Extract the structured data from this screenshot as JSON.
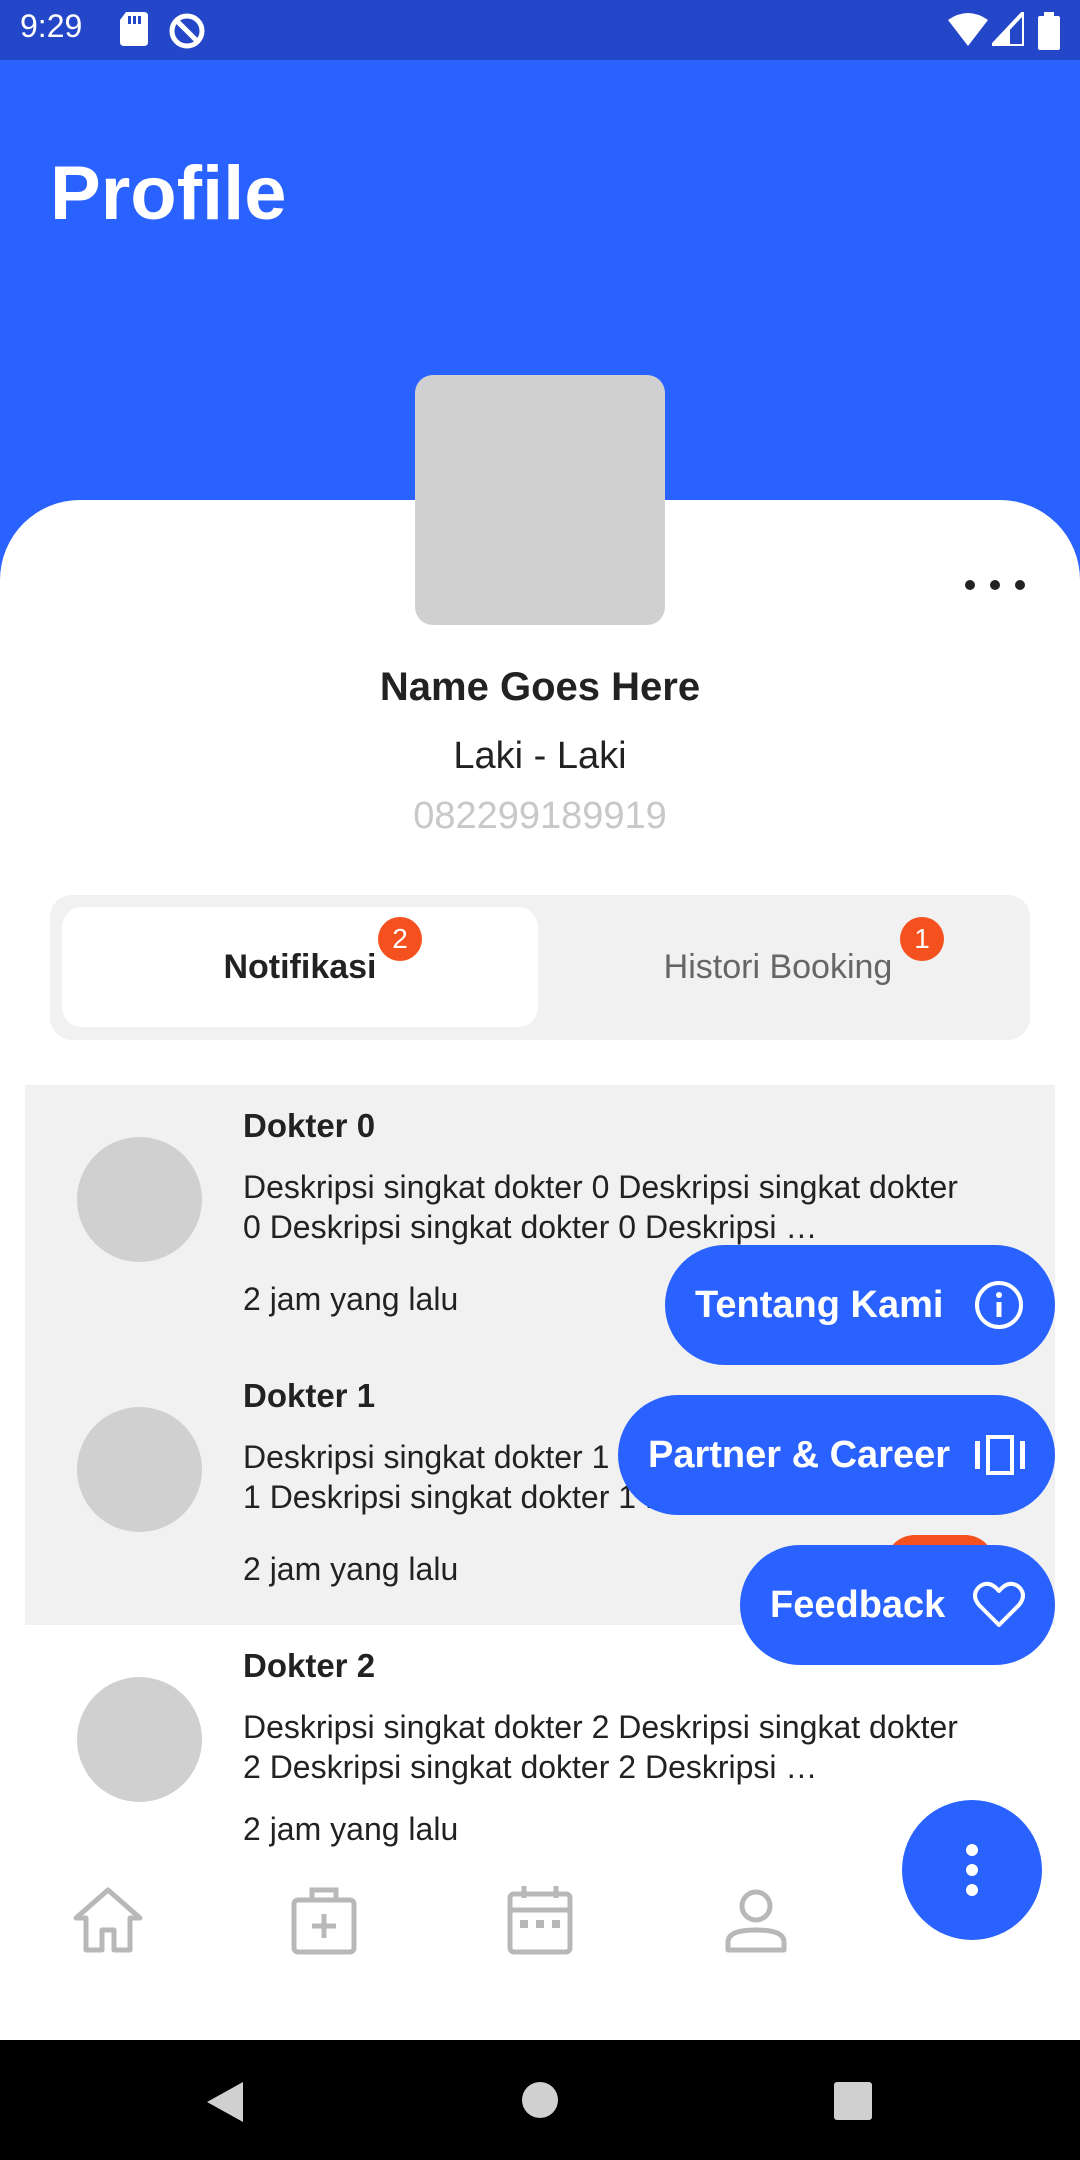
{
  "status_bar": {
    "time": "9:29"
  },
  "header": {
    "title": "Profile"
  },
  "profile": {
    "name": "Name Goes Here",
    "gender": "Laki - Laki",
    "phone": "082299189919"
  },
  "tabs": [
    {
      "label": "Notifikasi",
      "badge": "2",
      "active": true
    },
    {
      "label": "Histori Booking",
      "badge": "1",
      "active": false
    }
  ],
  "list": [
    {
      "title": "Dokter 0",
      "desc": "Deskripsi singkat dokter 0 Deskripsi singkat dokter 0 Deskripsi singkat dokter 0 Deskripsi …",
      "time": "2 jam yang lalu"
    },
    {
      "title": "Dokter 1",
      "desc": "Deskripsi singkat dokter 1 Deskripsi singkat dokter 1 Deskripsi singkat dokter 1 Deskripsi …",
      "time": "2 jam yang lalu"
    },
    {
      "title": "Dokter 2",
      "desc": "Deskripsi singkat dokter 2 Deskripsi singkat dokter 2 Deskripsi singkat dokter 2 Deskripsi …",
      "time": "2 jam yang lalu"
    }
  ],
  "speed_dial": {
    "about": {
      "label": "Tentang Kami",
      "icon": "info-icon"
    },
    "partner": {
      "label": "Partner & Career",
      "icon": "carousel-icon"
    },
    "feedback": {
      "label": "Feedback",
      "icon": "heart-icon"
    }
  },
  "bottom_nav": [
    {
      "icon": "home-icon"
    },
    {
      "icon": "medical-bag-icon"
    },
    {
      "icon": "calendar-icon"
    },
    {
      "icon": "person-icon"
    }
  ],
  "colors": {
    "primary": "#2962ff",
    "status_bar": "#2347c8",
    "badge": "#f4511e"
  }
}
